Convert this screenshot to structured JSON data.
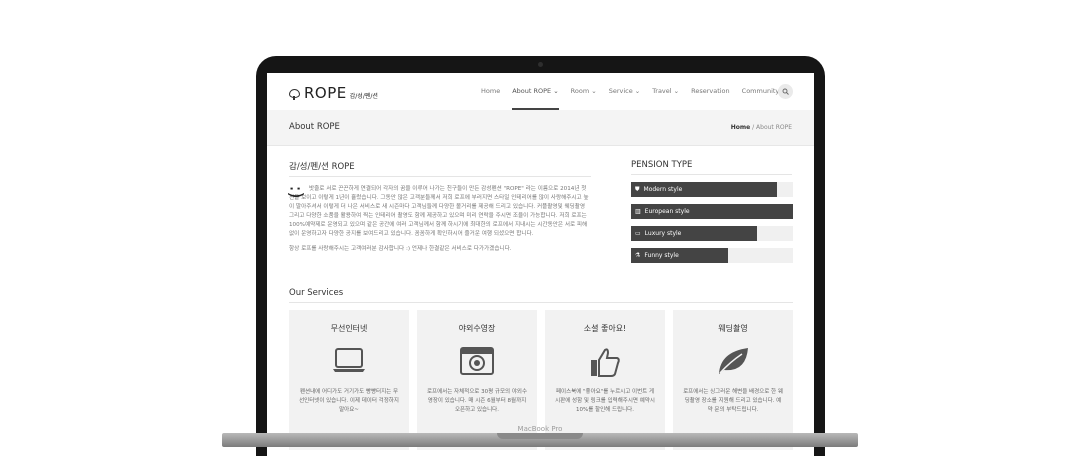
{
  "device_label": "MacBook Pro",
  "logo": {
    "text": "ROPE",
    "sub": "감/성/펜/션"
  },
  "nav": [
    {
      "label": "Home",
      "active": false
    },
    {
      "label": "About ROPE ⌄",
      "active": true
    },
    {
      "label": "Room ⌄",
      "active": false
    },
    {
      "label": "Service ⌄",
      "active": false
    },
    {
      "label": "Travel ⌄",
      "active": false
    },
    {
      "label": "Reservation",
      "active": false
    },
    {
      "label": "Community",
      "active": false
    }
  ],
  "page_title": "About ROPE",
  "breadcrumb": {
    "home": "Home",
    "sep": "/",
    "current": "About ROPE"
  },
  "about": {
    "title": "감/성/펜/션 ROPE",
    "paragraph1": "밧줄로 서로 끈끈하게 연결되어 각자의 꿈을 이루어 나가는 친구들이 만든 감성펜션 \"ROPE\" 라는 이름으로 2014년 첫 선을 보이고 이렇게 1년이 흘렀습니다. 그동안 많은 고객분들께서 저희 로프에 부러지면 스타일 인테리어를 많이 사랑해주시고 높이 말아주셔서 이렇게 더 나은 서비스로 새 시즌마다 고객님들께 다양한 볼거리를 제공해 드리고 있습니다. 커플촬영및 웨딩촬영 그리고 다양한 소품을 활용하여 찍는 인테리어 촬영도 함께 제공하고 있으며 미리 연락을 주시면 조율이 가능합니다. 저희 로프는 100%예약제로 운영되고 있으며 같은 공간에 여러 고객님께서 함께 하시기에 최대한의 로프에서 지내시는 시간동안은 서로 피해 없이 운영하고자 다양한 공지를 보여드리고 있습니다. 꼼꼼하게 확인하시어 즐거운 여행 되셨으면 합니다.",
    "paragraph2": "항상 로프를 사랑해주시는 고객여러분 감사합니다 :) 언제나 한결같은 서비스로 다가가겠습니다."
  },
  "pension_type": {
    "title": "PENSION TYPE",
    "items": [
      {
        "label": "Modern style",
        "icon": "ticket-icon",
        "glyph": "⛊",
        "value": 90
      },
      {
        "label": "European style",
        "icon": "building-icon",
        "glyph": "▥",
        "value": 100
      },
      {
        "label": "Luxury style",
        "icon": "laptop-icon",
        "glyph": "▭",
        "value": 78
      },
      {
        "label": "Funny style",
        "icon": "flask-icon",
        "glyph": "⚗",
        "value": 60
      }
    ]
  },
  "services": {
    "title": "Our Services",
    "cards": [
      {
        "title": "무선인터넷",
        "icon": "laptop-icon",
        "text": "펜션내에 어디가도 거기가도 빵빵터지는 무선인터넷이 있습니다. 이제 데이터 걱정하지 말아요~"
      },
      {
        "title": "야외수영장",
        "icon": "camera-icon",
        "text": "로프에서는 자체적으로 30평 규모의 야외수영장이 있습니다. 매 시즌 6월부터 8월까지 오픈하고 있습니다."
      },
      {
        "title": "소셜 좋아요!",
        "icon": "thumbs-up-icon",
        "text": "페이스북에 \"좋아요\"를 누르시고 이번트 게시판에 성함 및 링크를 입력해주시면 예약시 10%를 할인해 드립니다."
      },
      {
        "title": "웨딩촬영",
        "icon": "leaf-icon",
        "text": "로프에서는 싱그러운 해변을 배경으로 한 웨딩촬영 장소를 지원해 드리고 있습니다. 예약 문의 부탁드립니다."
      }
    ]
  }
}
